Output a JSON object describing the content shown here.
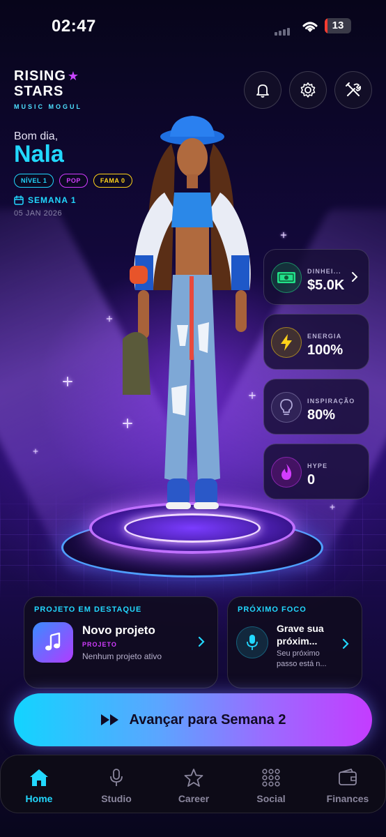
{
  "status_bar": {
    "time": "02:47",
    "battery": "13"
  },
  "brand": {
    "line1": "RISING",
    "line2": "STARS",
    "star": "★",
    "subtitle": "MUSIC MOGUL"
  },
  "header_icons": [
    "bell-icon",
    "gear-icon",
    "tools-icon"
  ],
  "player": {
    "greeting": "Bom dia,",
    "name": "Nala",
    "badges": {
      "level": "NÍVEL 1",
      "genre": "POP",
      "fame": "FAMA 0"
    },
    "week": "SEMANA 1",
    "date": "05 JAN 2026"
  },
  "stats": [
    {
      "label": "DINHEI...",
      "value": "$5.0K",
      "icon": "cash-icon",
      "color": "#22e08a"
    },
    {
      "label": "ENERGIA",
      "value": "100%",
      "icon": "bolt-icon",
      "color": "#ffd21a"
    },
    {
      "label": "INSPIRAÇÃO",
      "value": "80%",
      "icon": "lightbulb-icon",
      "color": "#b0a8d8"
    },
    {
      "label": "HYPE",
      "value": "0",
      "icon": "flame-icon",
      "color": "#d23cff"
    }
  ],
  "featured_project": {
    "title": "PROJETO EM DESTAQUE",
    "name": "Novo projeto",
    "tag": "PROJETO",
    "description": "Nenhum projeto ativo"
  },
  "next_focus": {
    "title": "PRÓXIMO FOCO",
    "line1": "Grave sua",
    "line2": "próxim...",
    "desc1": "Seu próximo",
    "desc2": "passo está n..."
  },
  "advance_button": {
    "label": "Avançar para Semana 2"
  },
  "tabs": [
    {
      "label": "Home",
      "active": true
    },
    {
      "label": "Studio",
      "active": false
    },
    {
      "label": "Career",
      "active": false
    },
    {
      "label": "Social",
      "active": false
    },
    {
      "label": "Finances",
      "active": false
    }
  ],
  "colors": {
    "accent_cyan": "#22d8ff",
    "accent_magenta": "#d23cff",
    "accent_yellow": "#ffd21a",
    "background": "#0a0720"
  }
}
